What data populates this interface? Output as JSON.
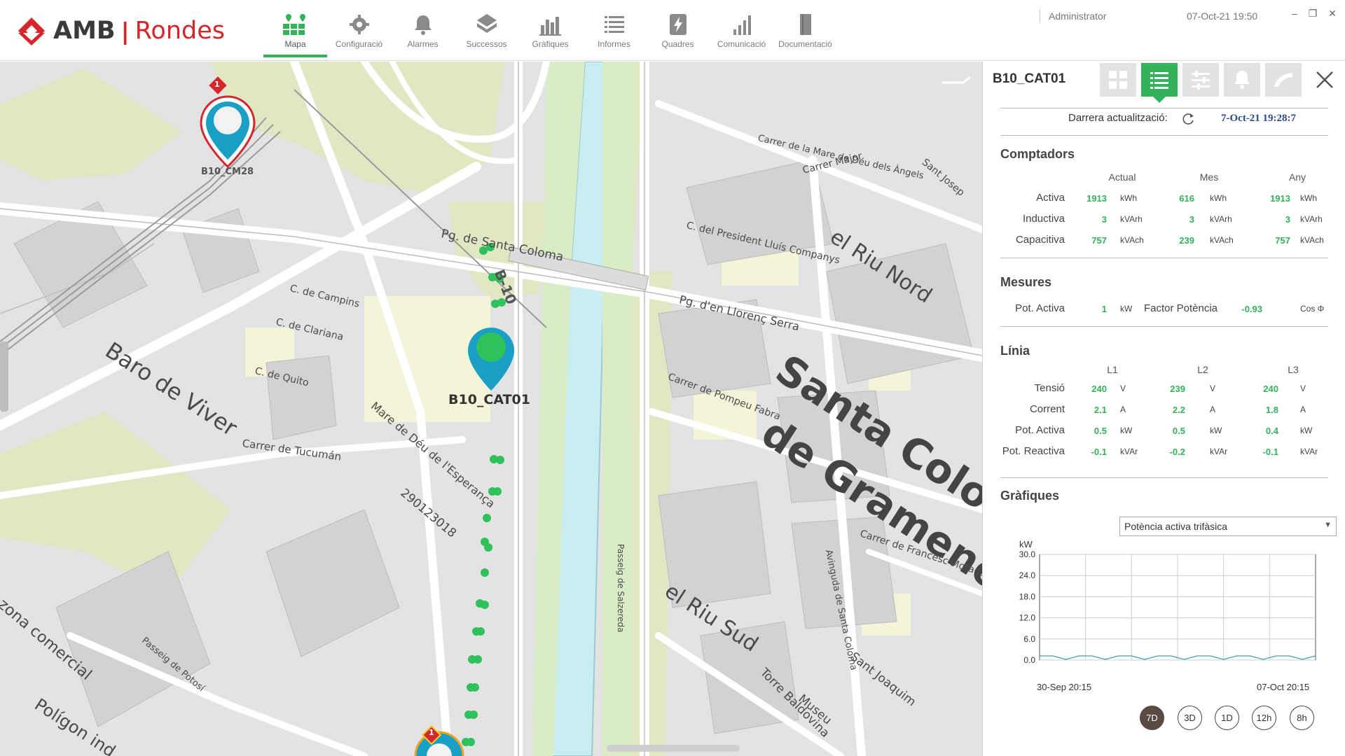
{
  "app": {
    "brand_left": "AMB",
    "brand_sep": "|",
    "brand_right": "Rondes",
    "user": "Administrator",
    "datetime": "07-Oct-21 19:50"
  },
  "nav": [
    {
      "label": "Mapa",
      "icon": "map-icon",
      "active": true
    },
    {
      "label": "Configuració",
      "icon": "gear-icon",
      "active": false
    },
    {
      "label": "Alarmes",
      "icon": "bell-icon",
      "active": false
    },
    {
      "label": "Successos",
      "icon": "events-icon",
      "active": false
    },
    {
      "label": "Gràfiques",
      "icon": "bar-chart-icon",
      "active": false
    },
    {
      "label": "Informes",
      "icon": "list-icon",
      "active": false
    },
    {
      "label": "Quadres",
      "icon": "lightning-icon",
      "active": false
    },
    {
      "label": "Comunicació",
      "icon": "signal-icon",
      "active": false
    },
    {
      "label": "Documentació",
      "icon": "document-icon",
      "active": false
    }
  ],
  "map": {
    "pins": [
      {
        "label": "B10_CM28",
        "badge": "1",
        "status": "alarm"
      },
      {
        "label": "B10_CAT01",
        "status": "ok"
      },
      {
        "badge": "1",
        "status": "alarm"
      }
    ],
    "labels": [
      "Pg. de Santa Coloma",
      "B-10",
      "Pg. d'en Llorenç Serra",
      "el Riu Nord",
      "Santa Coloma",
      "de Gramenet",
      "Baro de Viver",
      "Carrer de Tucumán",
      "Mare de Déu de l'Esperança",
      "290123018",
      "el Riu Sud",
      "Carrer de Pompeu Fabra",
      "C. del President Lluís Companys",
      "Carrer Major",
      "Sant Josep",
      "C. de Campins",
      "C. de Clariana",
      "C. de Quito",
      "Passeig de Potosí",
      "Polígon ind.",
      "zona comercial",
      "Torre Baldovina",
      "Museu",
      "Sant Joaquim",
      "Carrer de Francesc Moragas",
      "Avinguda de Santa Coloma",
      "Passeig de Salzereda",
      "Carrer de la Mare de Déu dels Àngels"
    ]
  },
  "panel": {
    "title": "B10_CAT01",
    "tools": [
      "grid-icon",
      "list-icon",
      "sliders-icon",
      "bell-icon",
      "lamp-icon"
    ],
    "updated_label": "Darrera actualització:",
    "updated_value": "7-Oct-21 19:28:7",
    "comptadors": {
      "title": "Comptadors",
      "columns": [
        "Actual",
        "Mes",
        "Any"
      ],
      "rows": [
        {
          "label": "Activa",
          "values": [
            "1913",
            "616",
            "1913"
          ],
          "units": [
            "kWh",
            "kWh",
            "kWh"
          ]
        },
        {
          "label": "Inductiva",
          "values": [
            "3",
            "3",
            "3"
          ],
          "units": [
            "kVArh",
            "kVArh",
            "kVArh"
          ]
        },
        {
          "label": "Capacitiva",
          "values": [
            "757",
            "239",
            "757"
          ],
          "units": [
            "kVAch",
            "kVAch",
            "kVAch"
          ]
        }
      ]
    },
    "mesures": {
      "title": "Mesures",
      "pot_label": "Pot. Activa",
      "pot_value": "1",
      "pot_unit": "kW",
      "factor_label": "Factor Potència",
      "factor_value": "-0.93",
      "factor_unit": "Cos Φ"
    },
    "linia": {
      "title": "Línia",
      "columns": [
        "L1",
        "L2",
        "L3"
      ],
      "rows": [
        {
          "label": "Tensió",
          "values": [
            "240",
            "239",
            "240"
          ],
          "units": [
            "V",
            "V",
            "V"
          ]
        },
        {
          "label": "Corrent",
          "values": [
            "2.1",
            "2.2",
            "1.8"
          ],
          "units": [
            "A",
            "A",
            "A"
          ]
        },
        {
          "label": "Pot. Activa",
          "values": [
            "0.5",
            "0.5",
            "0.4"
          ],
          "units": [
            "kW",
            "kW",
            "kW"
          ]
        },
        {
          "label": "Pot. Reactiva",
          "values": [
            "-0.1",
            "-0.2",
            "-0.1"
          ],
          "units": [
            "kVAr",
            "kVAr",
            "kVAr"
          ]
        }
      ]
    },
    "grafiques": {
      "title": "Gràfiques",
      "select_value": "Potència activa trifàsica",
      "ranges": [
        "7D",
        "3D",
        "1D",
        "12h",
        "8h"
      ],
      "active_range": "7D"
    }
  },
  "chart_data": {
    "type": "line",
    "ylabel": "kW",
    "ylim": [
      0,
      30
    ],
    "yticks": [
      "30.0",
      "24.0",
      "18.0",
      "12.0",
      "6.0",
      "0.0"
    ],
    "xlabels": [
      "30-Sep  20:15",
      "07-Oct  20:15"
    ],
    "grid": true,
    "series": [
      {
        "color": "#3aa0b5",
        "values": [
          1.2,
          1.2,
          0.2,
          1.2,
          1.2,
          0.2,
          1.2,
          1.2,
          0.2,
          1.2,
          1.2,
          0.2,
          1.2,
          1.2,
          0.2,
          1.2,
          1.2,
          0.2,
          1.2,
          1.2,
          0.2,
          1.2
        ]
      }
    ]
  }
}
